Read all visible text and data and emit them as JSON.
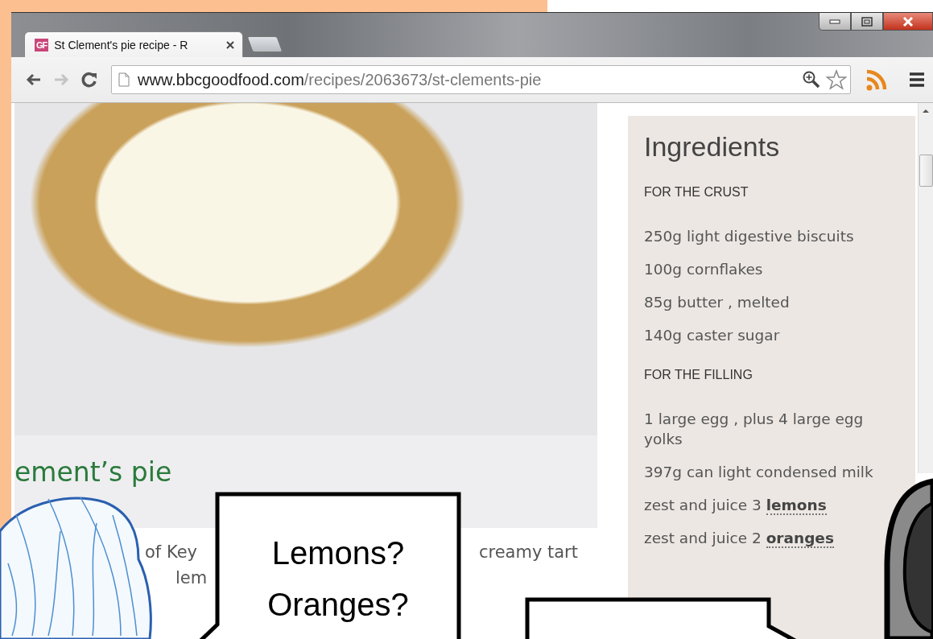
{
  "tabs": [
    {
      "favicon_text": "GF",
      "title": "St Clement's pie recipe - R",
      "selected": true
    }
  ],
  "address_bar": {
    "domain": "www.bbcgoodfood.com",
    "path": "/recipes/2063673/st-clements-pie"
  },
  "page": {
    "recipe_title": "ement’s pie",
    "description_fragments": [
      "of Key",
      "creamy tart",
      "lem"
    ]
  },
  "ingredients": {
    "heading": "Ingredients",
    "sections": [
      {
        "title": "FOR THE CRUST",
        "items": [
          "250g light digestive biscuits",
          "100g cornflakes",
          "85g butter , melted",
          "140g caster sugar"
        ]
      },
      {
        "title": "FOR THE FILLING",
        "items": [
          "1 large egg , plus 4 large egg yolks",
          "397g can light condensed milk",
          "zest and juice 3 **lemons**",
          "zest and juice 2 **oranges**"
        ]
      }
    ]
  },
  "speech_bubbles": [
    {
      "lines": [
        "Lemons?",
        "Oranges?"
      ]
    }
  ]
}
